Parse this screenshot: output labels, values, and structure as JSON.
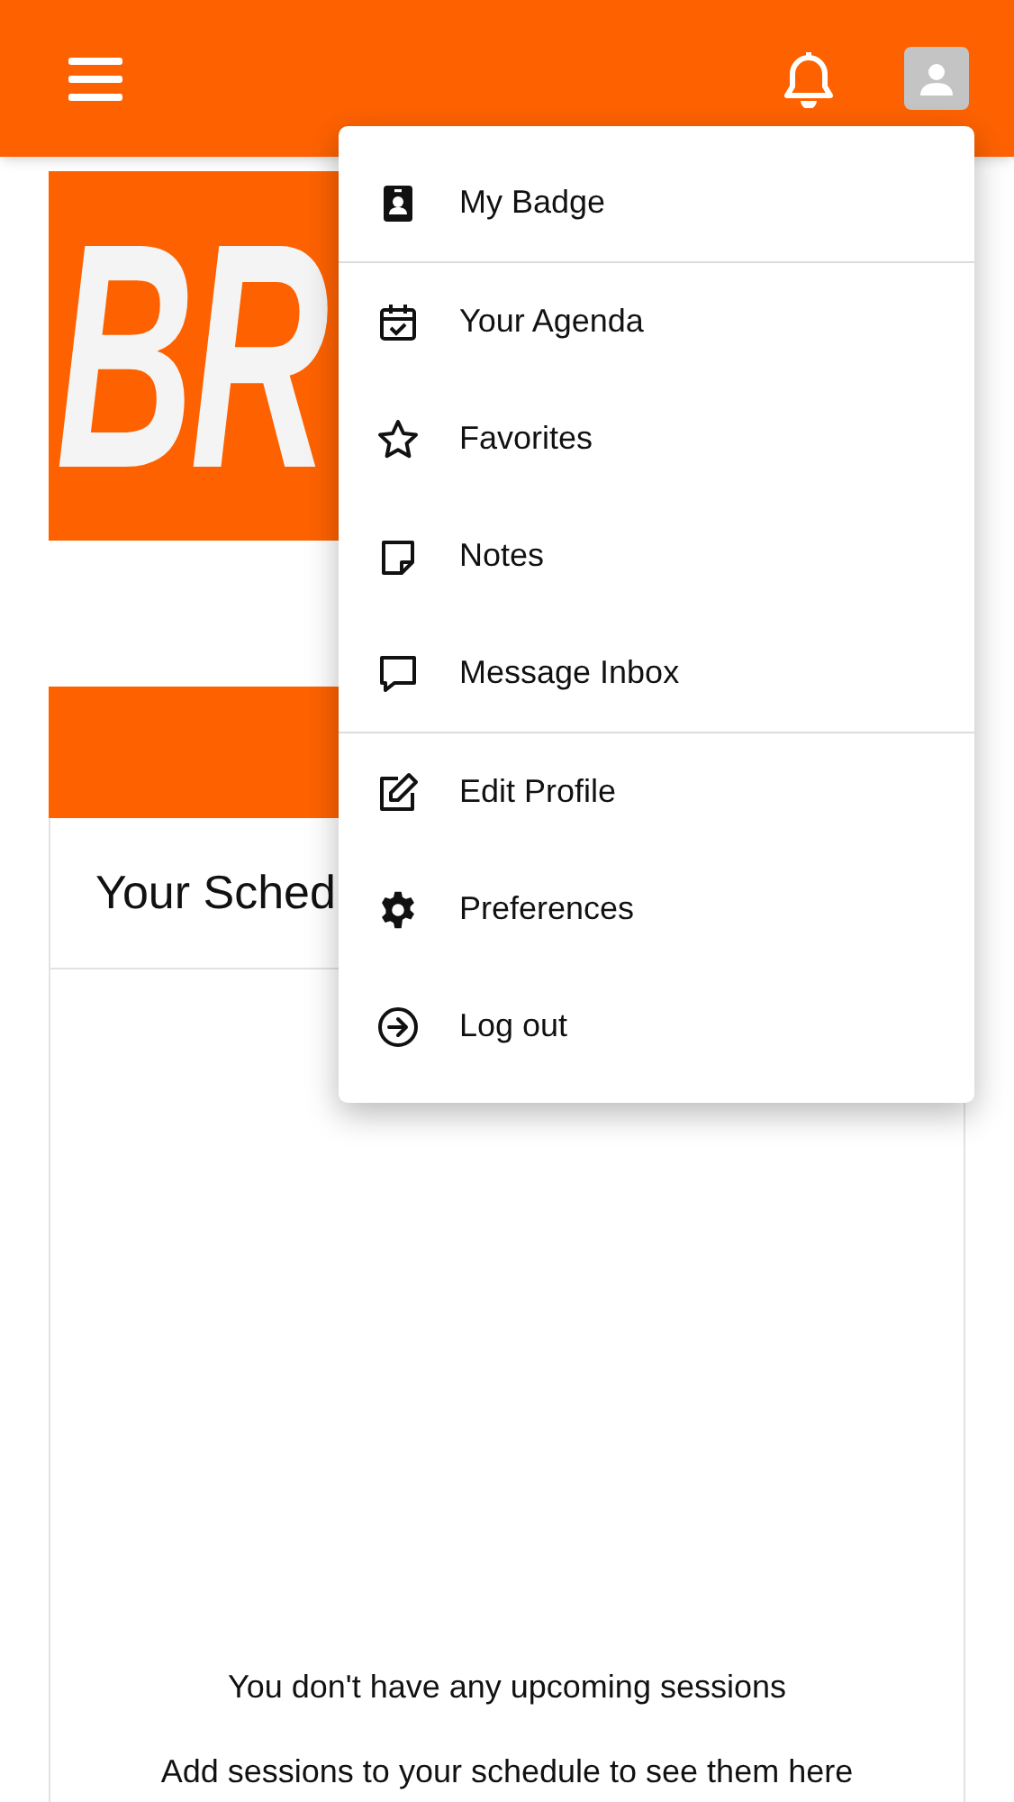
{
  "banner": {
    "text": "BR"
  },
  "schedule": {
    "title": "Your Sched",
    "empty_title": "You don't have any upcoming sessions",
    "empty_hint": "Add sessions to your schedule to see them here"
  },
  "user_menu": {
    "sections": [
      [
        {
          "label": "My Badge"
        }
      ],
      [
        {
          "label": "Your Agenda"
        },
        {
          "label": "Favorites"
        },
        {
          "label": "Notes"
        },
        {
          "label": "Message Inbox"
        }
      ],
      [
        {
          "label": "Edit Profile"
        },
        {
          "label": "Preferences"
        },
        {
          "label": "Log out"
        }
      ]
    ]
  }
}
